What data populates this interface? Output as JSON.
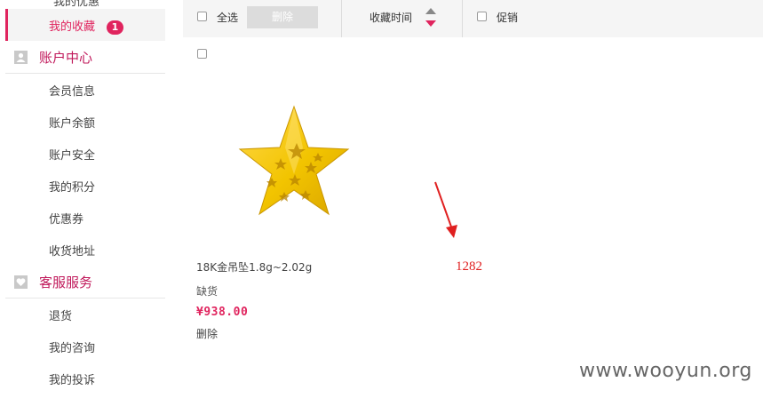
{
  "sidebar": {
    "clipped_label": "我的优惠",
    "active": {
      "label": "我的收藏",
      "badge": "1"
    },
    "sections": [
      {
        "title": "账户中心",
        "icon": "person-icon",
        "items": [
          "会员信息",
          "账户余额",
          "账户安全",
          "我的积分",
          "优惠券",
          "收货地址"
        ]
      },
      {
        "title": "客服服务",
        "icon": "heart-icon",
        "items": [
          "退货",
          "我的咨询",
          "我的投诉"
        ]
      }
    ]
  },
  "toolbar": {
    "select_all_label": "全选",
    "delete_label": "删除",
    "sort_label": "收藏时间",
    "promo_label": "促销"
  },
  "product": {
    "name": "18K金吊坠1.8g~2.02g",
    "stock": "缺货",
    "price": "¥938.00",
    "delete_label": "删除"
  },
  "annotation": {
    "number": "1282"
  },
  "watermark": "www.wooyun.org",
  "colors": {
    "accent": "#e0245e",
    "gold": "#f2c400",
    "annotation": "#e02020"
  }
}
